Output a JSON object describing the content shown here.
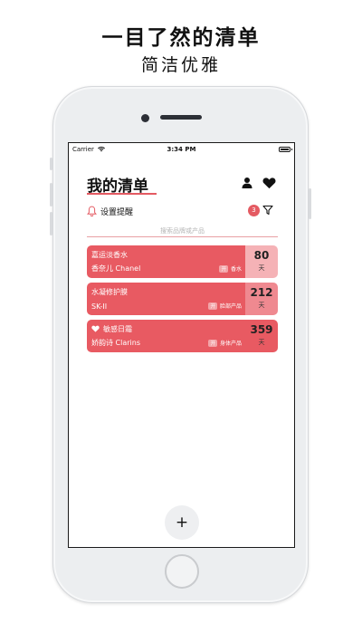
{
  "promo": {
    "title": "一目了然的清单",
    "subtitle": "简洁优雅"
  },
  "status_bar": {
    "carrier": "Carrier",
    "time": "3:34 PM"
  },
  "header": {
    "title": "我的清单",
    "icons": [
      "user-icon",
      "heart-icon"
    ]
  },
  "reminder": {
    "label": "设置提醒",
    "badge_count": "3"
  },
  "search": {
    "placeholder": "搜索品牌或产品"
  },
  "items": [
    {
      "name": "香奈儿Chanel",
      "product": "嘉运淡香水",
      "brand": "香奈儿 Chanel",
      "tag_box": "开",
      "category": "香水",
      "days": "80",
      "unit": "天",
      "favorite": false,
      "main_color": "#e85a62",
      "side_color": "#f5b2b6"
    },
    {
      "product": "水凝修护膜",
      "brand": "SK-II",
      "tag_box": "开",
      "category": "脸部产品",
      "days": "212",
      "unit": "天",
      "favorite": false,
      "main_color": "#e85a62",
      "side_color": "#ef8990"
    },
    {
      "product": "敏感日霜",
      "brand": "娇韵诗 Clarins",
      "tag_box": "开",
      "category": "身体产品",
      "days": "359",
      "unit": "天",
      "favorite": true,
      "main_color": "#e85a62",
      "side_color": "#e85a62"
    }
  ],
  "add_button": {
    "label": "+"
  },
  "colors": {
    "accent": "#e45a62",
    "card": "#e85a62"
  }
}
